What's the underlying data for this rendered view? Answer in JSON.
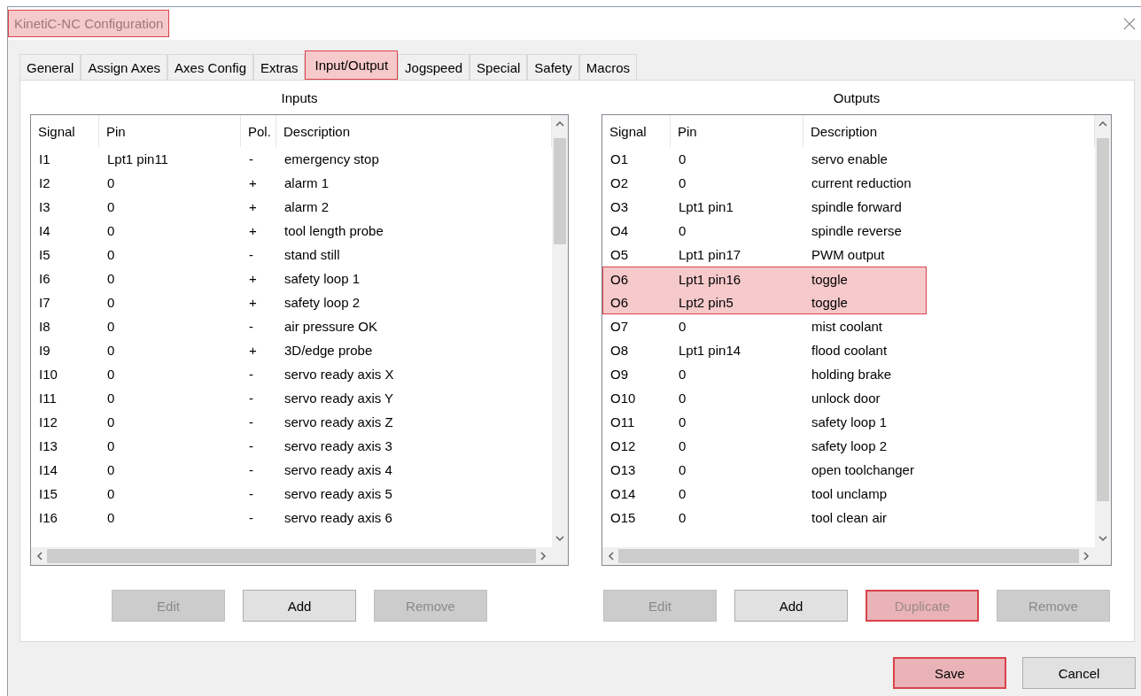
{
  "window": {
    "title": "KinetiC-NC Configuration",
    "highlighted": true
  },
  "tabs": [
    {
      "label": "General",
      "selected": false,
      "highlighted": false
    },
    {
      "label": "Assign Axes",
      "selected": false,
      "highlighted": false
    },
    {
      "label": "Axes Config",
      "selected": false,
      "highlighted": false
    },
    {
      "label": "Extras",
      "selected": false,
      "highlighted": false
    },
    {
      "label": "Input/Output",
      "selected": true,
      "highlighted": true
    },
    {
      "label": "Jogspeed",
      "selected": false,
      "highlighted": false
    },
    {
      "label": "Special",
      "selected": false,
      "highlighted": false
    },
    {
      "label": "Safety",
      "selected": false,
      "highlighted": false
    },
    {
      "label": "Macros",
      "selected": false,
      "highlighted": false
    }
  ],
  "inputs": {
    "heading": "Inputs",
    "columns": [
      "Signal",
      "Pin",
      "Pol.",
      "Description"
    ],
    "rows": [
      {
        "cells": [
          "I1",
          "Lpt1 pin11",
          "-",
          "emergency stop"
        ],
        "highlighted": false
      },
      {
        "cells": [
          "I2",
          "0",
          "+",
          "alarm 1"
        ],
        "highlighted": false
      },
      {
        "cells": [
          "I3",
          "0",
          "+",
          "alarm 2"
        ],
        "highlighted": false
      },
      {
        "cells": [
          "I4",
          "0",
          "+",
          "tool length probe"
        ],
        "highlighted": false
      },
      {
        "cells": [
          "I5",
          "0",
          "-",
          "stand still"
        ],
        "highlighted": false
      },
      {
        "cells": [
          "I6",
          "0",
          "+",
          "safety loop 1"
        ],
        "highlighted": false
      },
      {
        "cells": [
          "I7",
          "0",
          "+",
          "safety loop 2"
        ],
        "highlighted": false
      },
      {
        "cells": [
          "I8",
          "0",
          "-",
          "air pressure OK"
        ],
        "highlighted": false
      },
      {
        "cells": [
          "I9",
          "0",
          "+",
          "3D/edge probe"
        ],
        "highlighted": false
      },
      {
        "cells": [
          "I10",
          "0",
          "-",
          "servo ready axis X"
        ],
        "highlighted": false
      },
      {
        "cells": [
          "I11",
          "0",
          "-",
          "servo ready axis Y"
        ],
        "highlighted": false
      },
      {
        "cells": [
          "I12",
          "0",
          "-",
          "servo ready axis Z"
        ],
        "highlighted": false
      },
      {
        "cells": [
          "I13",
          "0",
          "-",
          "servo ready axis 3"
        ],
        "highlighted": false
      },
      {
        "cells": [
          "I14",
          "0",
          "-",
          "servo ready axis 4"
        ],
        "highlighted": false
      },
      {
        "cells": [
          "I15",
          "0",
          "-",
          "servo ready axis 5"
        ],
        "highlighted": false
      },
      {
        "cells": [
          "I16",
          "0",
          "-",
          "servo ready axis 6"
        ],
        "highlighted": false
      }
    ],
    "buttons": [
      {
        "label": "Edit",
        "disabled": true,
        "highlighted": false
      },
      {
        "label": "Add",
        "disabled": false,
        "highlighted": false
      },
      {
        "label": "Remove",
        "disabled": true,
        "highlighted": false
      }
    ]
  },
  "outputs": {
    "heading": "Outputs",
    "columns": [
      "Signal",
      "Pin",
      "Description"
    ],
    "rows": [
      {
        "cells": [
          "O1",
          "0",
          "servo enable"
        ],
        "highlighted": false
      },
      {
        "cells": [
          "O2",
          "0",
          "current reduction"
        ],
        "highlighted": false
      },
      {
        "cells": [
          "O3",
          "Lpt1 pin1",
          "spindle forward"
        ],
        "highlighted": false
      },
      {
        "cells": [
          "O4",
          "0",
          "spindle reverse"
        ],
        "highlighted": false
      },
      {
        "cells": [
          "O5",
          "Lpt1 pin17",
          "PWM output"
        ],
        "highlighted": false
      },
      {
        "cells": [
          "O6",
          "Lpt1 pin16",
          "toggle"
        ],
        "highlighted": true
      },
      {
        "cells": [
          "O6",
          "Lpt2 pin5",
          "toggle"
        ],
        "highlighted": true
      },
      {
        "cells": [
          "O7",
          "0",
          "mist coolant"
        ],
        "highlighted": false
      },
      {
        "cells": [
          "O8",
          "Lpt1 pin14",
          "flood coolant"
        ],
        "highlighted": false
      },
      {
        "cells": [
          "O9",
          "0",
          "holding brake"
        ],
        "highlighted": false
      },
      {
        "cells": [
          "O10",
          "0",
          "unlock door"
        ],
        "highlighted": false
      },
      {
        "cells": [
          "O11",
          "0",
          "safety loop 1"
        ],
        "highlighted": false
      },
      {
        "cells": [
          "O12",
          "0",
          "safety loop 2"
        ],
        "highlighted": false
      },
      {
        "cells": [
          "O13",
          "0",
          "open toolchanger"
        ],
        "highlighted": false
      },
      {
        "cells": [
          "O14",
          "0",
          "tool unclamp"
        ],
        "highlighted": false
      },
      {
        "cells": [
          "O15",
          "0",
          "tool clean air"
        ],
        "highlighted": false
      }
    ],
    "buttons": [
      {
        "label": "Edit",
        "disabled": true,
        "highlighted": false
      },
      {
        "label": "Add",
        "disabled": false,
        "highlighted": false
      },
      {
        "label": "Duplicate",
        "disabled": true,
        "highlighted": true
      },
      {
        "label": "Remove",
        "disabled": true,
        "highlighted": false
      }
    ]
  },
  "footer_buttons": [
    {
      "label": "Save",
      "disabled": false,
      "highlighted": true
    },
    {
      "label": "Cancel",
      "disabled": false,
      "highlighted": false
    }
  ]
}
